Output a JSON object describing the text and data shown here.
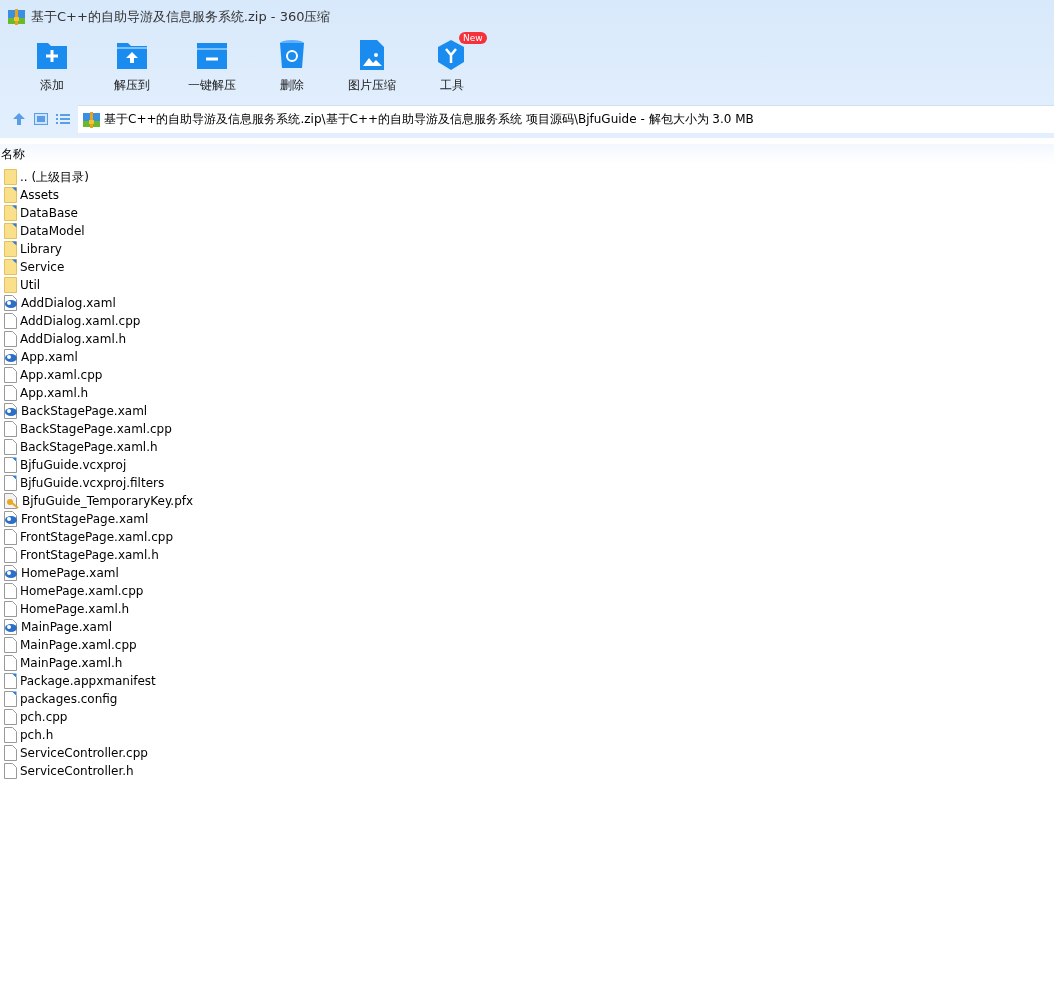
{
  "window": {
    "title": "基于C++的自助导游及信息服务系统.zip - 360压缩"
  },
  "toolbar": [
    {
      "kind": "add",
      "label": "添加"
    },
    {
      "kind": "extract",
      "label": "解压到"
    },
    {
      "kind": "oneclick",
      "label": "一键解压"
    },
    {
      "kind": "delete",
      "label": "删除"
    },
    {
      "kind": "image",
      "label": "图片压缩"
    },
    {
      "kind": "tools",
      "label": "工具",
      "badge": "New"
    }
  ],
  "path": "基于C++的自助导游及信息服务系统.zip\\基于C++的自助导游及信息服务系统 项目源码\\BjfuGuide - 解包大小为 3.0 MB",
  "table": {
    "columns": [
      "名称"
    ],
    "rows": [
      {
        "kind": "up",
        "name": ".. (上级目录)"
      },
      {
        "kind": "folder",
        "name": "Assets"
      },
      {
        "kind": "folder",
        "name": "DataBase"
      },
      {
        "kind": "folder",
        "name": "DataModel"
      },
      {
        "kind": "folder",
        "name": "Library"
      },
      {
        "kind": "folder",
        "name": "Service"
      },
      {
        "kind": "up",
        "name": "Util"
      },
      {
        "kind": "xaml",
        "name": "AddDialog.xaml"
      },
      {
        "kind": "file",
        "name": "AddDialog.xaml.cpp"
      },
      {
        "kind": "file",
        "name": "AddDialog.xaml.h"
      },
      {
        "kind": "xaml",
        "name": "App.xaml"
      },
      {
        "kind": "file",
        "name": "App.xaml.cpp"
      },
      {
        "kind": "file",
        "name": "App.xaml.h"
      },
      {
        "kind": "xaml",
        "name": "BackStagePage.xaml"
      },
      {
        "kind": "file",
        "name": "BackStagePage.xaml.cpp"
      },
      {
        "kind": "file",
        "name": "BackStagePage.xaml.h"
      },
      {
        "kind": "project",
        "name": "BjfuGuide.vcxproj"
      },
      {
        "kind": "project",
        "name": "BjfuGuide.vcxproj.filters"
      },
      {
        "kind": "key",
        "name": "BjfuGuide_TemporaryKey.pfx"
      },
      {
        "kind": "xaml",
        "name": "FrontStagePage.xaml"
      },
      {
        "kind": "file",
        "name": "FrontStagePage.xaml.cpp"
      },
      {
        "kind": "file",
        "name": "FrontStagePage.xaml.h"
      },
      {
        "kind": "xaml",
        "name": "HomePage.xaml"
      },
      {
        "kind": "file",
        "name": "HomePage.xaml.cpp"
      },
      {
        "kind": "file",
        "name": "HomePage.xaml.h"
      },
      {
        "kind": "xaml",
        "name": "MainPage.xaml"
      },
      {
        "kind": "file",
        "name": "MainPage.xaml.cpp"
      },
      {
        "kind": "file",
        "name": "MainPage.xaml.h"
      },
      {
        "kind": "project",
        "name": "Package.appxmanifest"
      },
      {
        "kind": "project",
        "name": "packages.config"
      },
      {
        "kind": "file",
        "name": "pch.cpp"
      },
      {
        "kind": "file",
        "name": "pch.h"
      },
      {
        "kind": "file",
        "name": "ServiceController.cpp"
      },
      {
        "kind": "file",
        "name": "ServiceController.h"
      }
    ]
  }
}
